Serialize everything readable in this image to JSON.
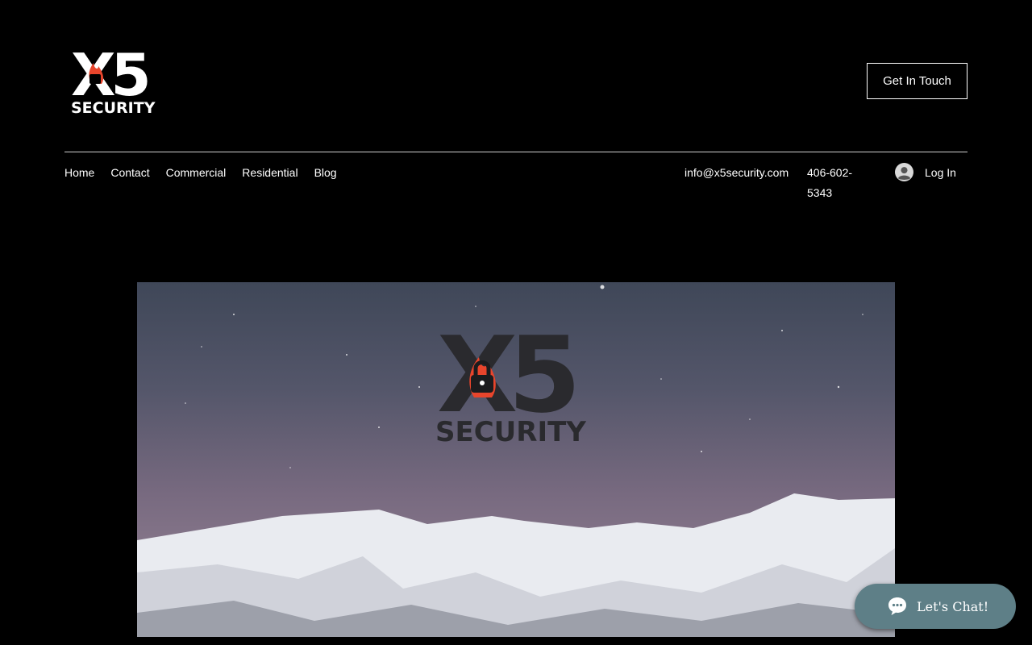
{
  "brand": {
    "logo_text": "X5",
    "logo_subtext": "SECURITY"
  },
  "header": {
    "cta_label": "Get In Touch"
  },
  "nav": {
    "items": [
      "Home",
      "Contact",
      "Commercial",
      "Residential",
      "Blog"
    ]
  },
  "contact": {
    "email": "info@x5security.com",
    "phone": "406-602-5343"
  },
  "account": {
    "login_label": "Log In"
  },
  "hero": {
    "logo_text": "X5",
    "logo_subtext": "SECURITY"
  },
  "chat": {
    "label": "Let's Chat!"
  },
  "colors": {
    "background": "#000000",
    "accent_flame": "#e8452c",
    "chat_bg": "#5e7f87"
  }
}
